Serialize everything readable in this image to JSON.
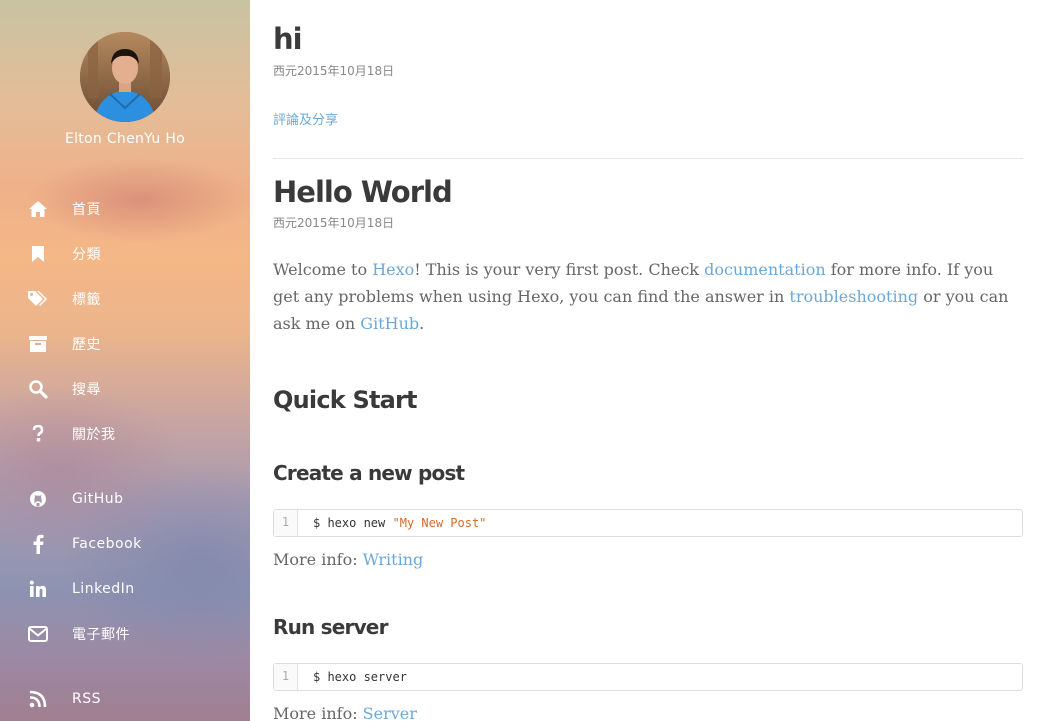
{
  "sidebar": {
    "author_name": "Elton ChenYu Ho",
    "nav": [
      {
        "label": "首頁",
        "icon": "home-icon"
      },
      {
        "label": "分類",
        "icon": "bookmark-icon"
      },
      {
        "label": "標籤",
        "icon": "tags-icon"
      },
      {
        "label": "歷史",
        "icon": "archive-icon"
      },
      {
        "label": "搜尋",
        "icon": "search-icon"
      },
      {
        "label": "關於我",
        "icon": "question-icon"
      }
    ],
    "social": [
      {
        "label": "GitHub",
        "icon": "github-icon"
      },
      {
        "label": "Facebook",
        "icon": "facebook-icon"
      },
      {
        "label": "LinkedIn",
        "icon": "linkedin-icon"
      },
      {
        "label": "電子郵件",
        "icon": "envelope-icon"
      }
    ],
    "rss": {
      "label": "RSS",
      "icon": "rss-icon"
    }
  },
  "posts": [
    {
      "title": "hi",
      "date": "西元2015年10月18日",
      "comment_link": "評論及分享"
    },
    {
      "title": "Hello World",
      "date": "西元2015年10月18日",
      "intro": {
        "t1": "Welcome to ",
        "link_hexo": "Hexo",
        "t2": "! This is your very first post. Check ",
        "link_docs": "documentation",
        "t3": " for more info. If you get any problems when using Hexo, you can find the answer in ",
        "link_troubleshooting": "troubleshooting",
        "t4": " or you can ask me on ",
        "link_github": "GitHub",
        "t5": "."
      },
      "quick_start_heading": "Quick Start",
      "sections": [
        {
          "heading": "Create a new post",
          "line_number": "1",
          "code_prefix": "$ hexo new ",
          "code_string": "\"My New Post\"",
          "more_info_label": "More info: ",
          "more_info_link": "Writing"
        },
        {
          "heading": "Run server",
          "line_number": "1",
          "code_prefix": "$ hexo server",
          "code_string": "",
          "more_info_label": "More info: ",
          "more_info_link": "Server"
        }
      ]
    }
  ],
  "colors": {
    "link": "#6ba8d8",
    "heading": "#3a3a3a",
    "code_string": "#d46a2a"
  }
}
